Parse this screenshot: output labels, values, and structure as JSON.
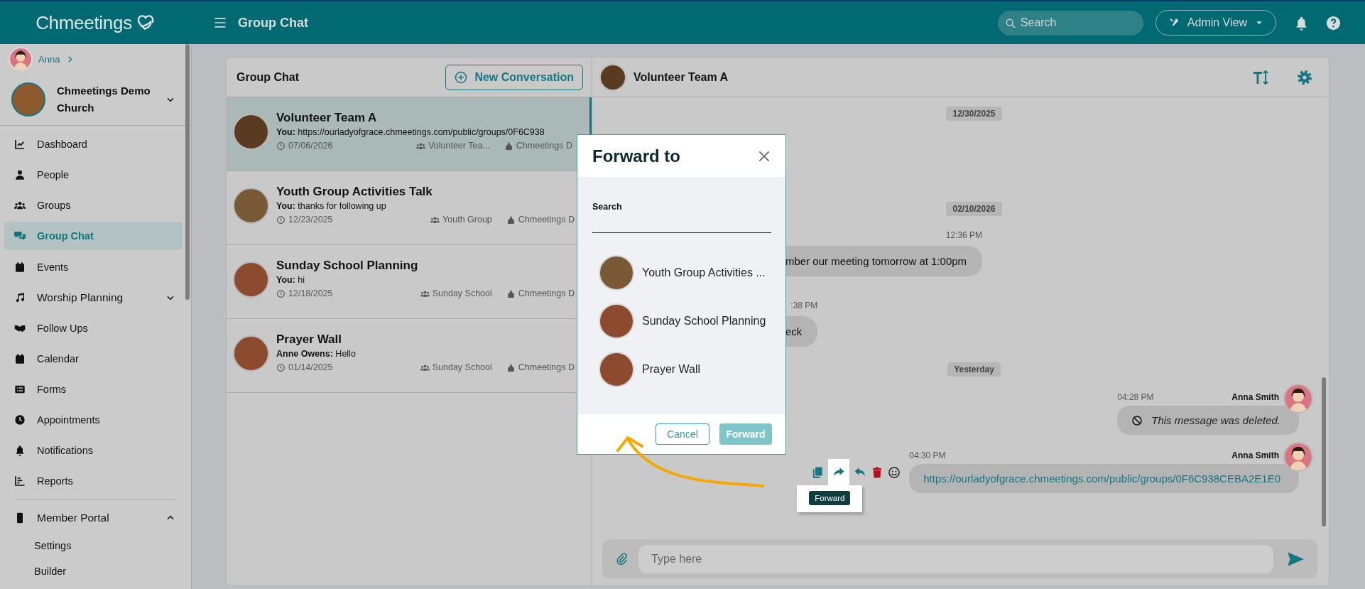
{
  "topbar": {
    "logo": "Chmeetings",
    "title": "Group Chat",
    "search": {
      "placeholder": "Search"
    },
    "view_button": "Admin View"
  },
  "sidebar": {
    "user": "Anna",
    "church": "Chmeetings Demo Church",
    "items": [
      {
        "label": "Dashboard",
        "selected": false
      },
      {
        "label": "People",
        "selected": false
      },
      {
        "label": "Groups",
        "selected": false
      },
      {
        "label": "Group Chat",
        "selected": true
      },
      {
        "label": "Events",
        "selected": false
      },
      {
        "label": "Worship Planning",
        "selected": false,
        "expanded": false
      },
      {
        "label": "Follow Ups",
        "selected": false
      },
      {
        "label": "Calendar",
        "selected": false
      },
      {
        "label": "Forms",
        "selected": false
      },
      {
        "label": "Appointments",
        "selected": false
      },
      {
        "label": "Notifications",
        "selected": false
      },
      {
        "label": "Reports",
        "selected": false
      },
      {
        "label": "Member Portal",
        "selected": false,
        "expanded": true,
        "divider_before": true,
        "children": [
          {
            "label": "Settings",
            "selected": false
          },
          {
            "label": "Builder",
            "selected": false
          }
        ]
      }
    ]
  },
  "conversations": {
    "title": "Group Chat",
    "new_button": "New Conversation",
    "items": [
      {
        "name": "Volunteer Team A",
        "sender": "You:",
        "message": "https://ourladyofgrace.chmeetings.com/public/groups/0F6C938",
        "date": "07/06/2026",
        "group": "Volunteer Tea...",
        "church": "Chmeetings D",
        "selected": true
      },
      {
        "name": "Youth Group Activities Talk",
        "sender": "You:",
        "message": "thanks for following up",
        "date": "12/23/2025",
        "group": "Youth Group",
        "church": "Chmeetings D",
        "selected": false
      },
      {
        "name": "Sunday School Planning",
        "sender": "You:",
        "message": "hi",
        "date": "12/18/2025",
        "group": "Sunday School",
        "church": "Chmeetings D",
        "selected": false
      },
      {
        "name": "Prayer Wall",
        "sender": "Anne Owens:",
        "message": "Hello",
        "date": "01/14/2025",
        "group": "Sunday School",
        "church": "Chmeetings D",
        "selected": false
      }
    ]
  },
  "chat": {
    "title": "Volunteer Team A",
    "messages": [
      {
        "kind": "date",
        "text": "12/30/2025"
      },
      {
        "kind": "date",
        "text": "02/10/2026"
      },
      {
        "kind": "incoming",
        "time": "12:36 PM",
        "text": "mber our meeting tomorrow at 1:00pm"
      },
      {
        "kind": "incoming",
        "time": ":38 PM",
        "text": "eck"
      },
      {
        "kind": "date",
        "text": "Yesterday"
      },
      {
        "kind": "deleted",
        "time": "04:28 PM",
        "sender": "Anna Smith",
        "text": "This message was deleted."
      },
      {
        "kind": "link",
        "time": "04:30 PM",
        "sender": "Anna Smith",
        "text": "https://ourladyofgrace.chmeetings.com/public/groups/0F6C938CEBA2E1E0",
        "actions_visible": true,
        "tooltip": "Forward"
      }
    ],
    "composer": {
      "placeholder": "Type here"
    }
  },
  "modal": {
    "title": "Forward to",
    "search_label": "Search",
    "targets": [
      {
        "name": "Youth Group Activities ..."
      },
      {
        "name": "Sunday School Planning"
      },
      {
        "name": "Prayer Wall"
      }
    ],
    "cancel": "Cancel",
    "forward": {
      "label": "Forward",
      "disabled": true
    }
  }
}
